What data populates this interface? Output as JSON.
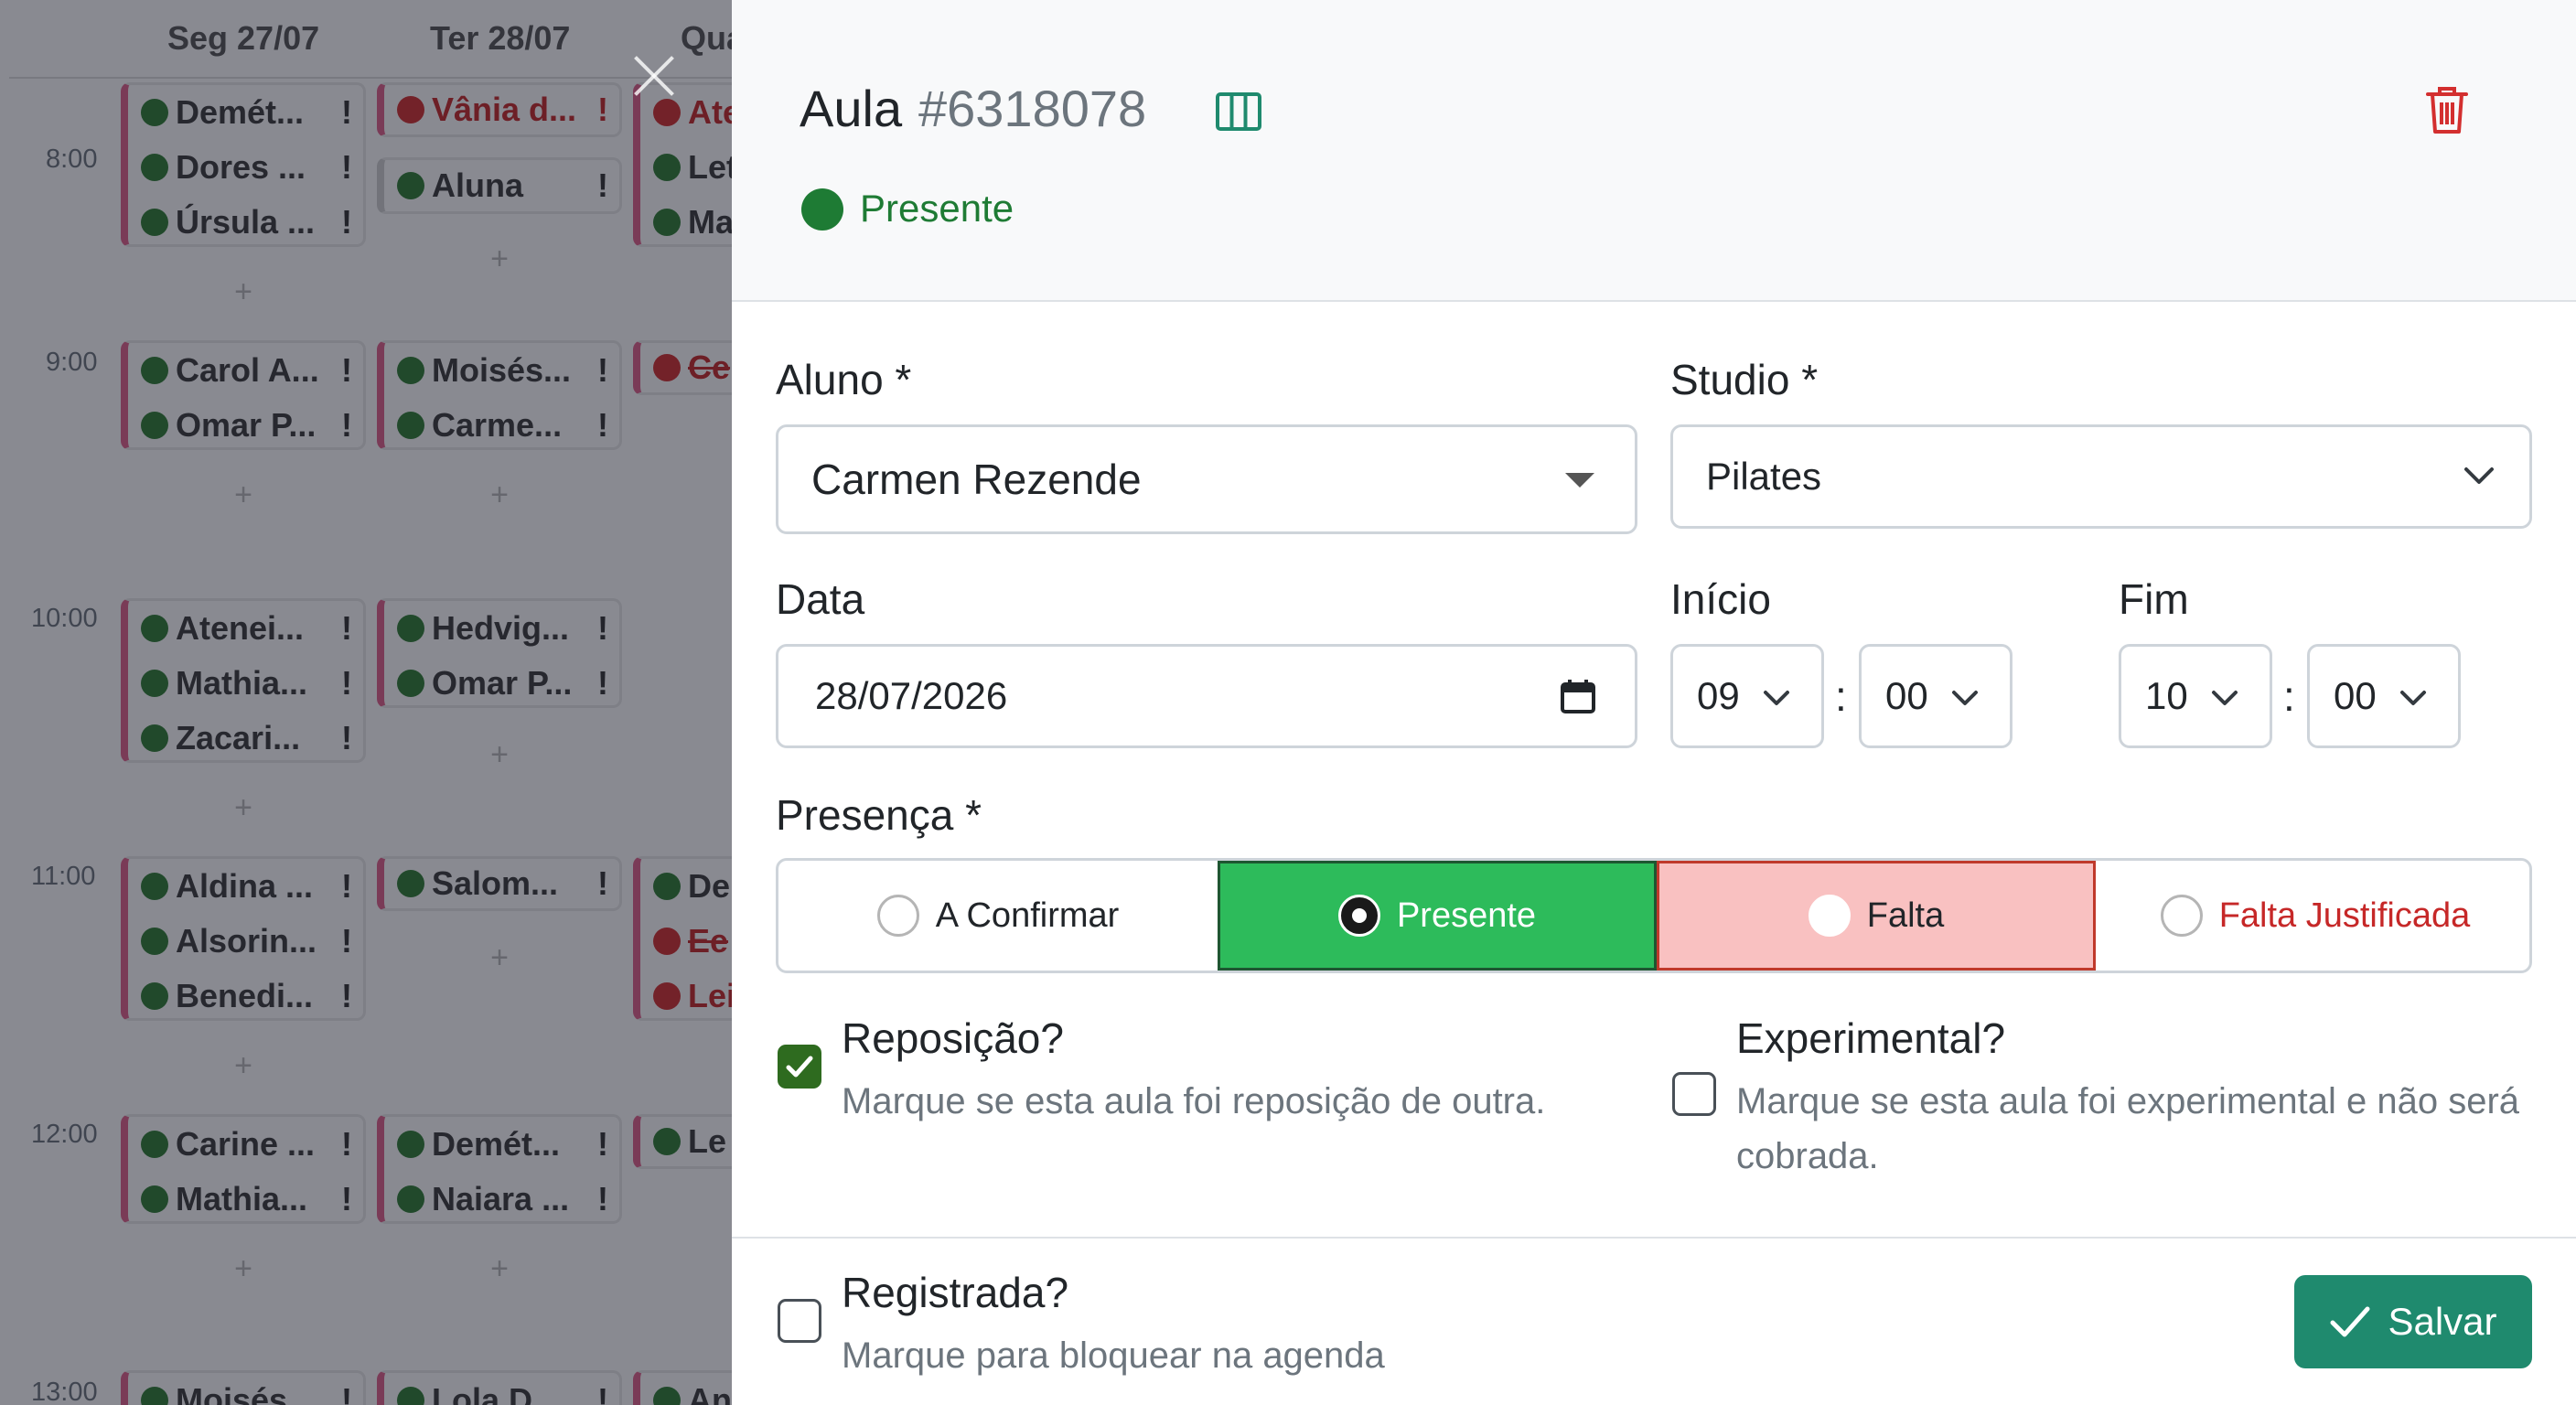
{
  "calendar": {
    "days": [
      "Seg 27/07",
      "Ter 28/07",
      "Qua"
    ],
    "times": [
      "8:00",
      "9:00",
      "10:00",
      "11:00",
      "12:00",
      "13:00"
    ],
    "plus_symbol": "+",
    "warn_symbol": "!",
    "events": {
      "mon_8": [
        "Demét...",
        "Dores ...",
        "Úrsula ..."
      ],
      "tue_8a": [
        "Vânia d..."
      ],
      "tue_8b": [
        "Aluna"
      ],
      "wed_8": [
        "Ate",
        "Let",
        "Ma"
      ],
      "mon_9": [
        "Carol A...",
        "Omar P..."
      ],
      "tue_9": [
        "Moisés...",
        "Carme..."
      ],
      "wed_9": [
        "Ce"
      ],
      "mon_10": [
        "Atenei...",
        "Mathia...",
        "Zacari..."
      ],
      "tue_10": [
        "Hedvig...",
        "Omar P..."
      ],
      "mon_11": [
        "Aldina ...",
        "Alsorin...",
        "Benedi..."
      ],
      "tue_11": [
        "Salom..."
      ],
      "wed_11": [
        "De",
        "Ee",
        "Lei"
      ],
      "mon_12": [
        "Carine ...",
        "Mathia..."
      ],
      "tue_12": [
        "Demét...",
        "Naiara ..."
      ],
      "wed_12": [
        "Le"
      ],
      "mon_13": [
        "Moisés"
      ],
      "tue_13": [
        "Lola D"
      ],
      "wed_13": [
        "An"
      ]
    }
  },
  "drawer": {
    "title": "Aula",
    "id": "#6318078",
    "status": {
      "text": "Presente",
      "color": "#1e7b34"
    },
    "form": {
      "aluno": {
        "label": "Aluno *",
        "value": "Carmen Rezende"
      },
      "studio": {
        "label": "Studio *",
        "value": "Pilates"
      },
      "data": {
        "label": "Data",
        "value": "28/07/2026"
      },
      "inicio": {
        "label": "Início",
        "hour": "09",
        "minute": "00"
      },
      "fim": {
        "label": "Fim",
        "hour": "10",
        "minute": "00"
      },
      "time_separator": ":",
      "presenca": {
        "label": "Presença *",
        "options": [
          "A Confirmar",
          "Presente",
          "Falta",
          "Falta Justificada"
        ],
        "selected": "Presente"
      },
      "reposicao": {
        "label": "Reposição?",
        "help": "Marque se esta aula foi reposição de outra.",
        "checked": true
      },
      "experimental": {
        "label": "Experimental?",
        "help": "Marque se esta aula foi experimental e não será cobrada.",
        "checked": false
      },
      "registrada": {
        "label": "Registrada?",
        "help": "Marque para bloquear na agenda",
        "checked": false
      }
    },
    "save_label": "Salvar",
    "colors": {
      "accent": "#1f8a6e",
      "present": "#2dbb5b",
      "absent_bg": "#f9c1c1",
      "danger": "#d32f2f"
    }
  }
}
